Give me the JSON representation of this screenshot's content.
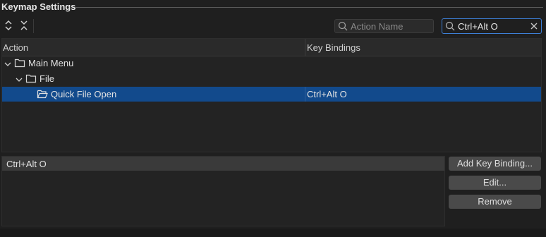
{
  "section": {
    "title": "Keymap Settings"
  },
  "toolbar": {
    "expand_icon": "expand-all-icon",
    "collapse_icon": "collapse-all-icon"
  },
  "search": {
    "action_placeholder": "Action Name",
    "binding_value": "Ctrl+Alt O"
  },
  "table": {
    "columns": [
      "Action",
      "Key Bindings"
    ],
    "rows": [
      {
        "label": "Main Menu",
        "binding": "",
        "type": "folder"
      },
      {
        "label": "File",
        "binding": "",
        "type": "folder"
      },
      {
        "label": "Quick File Open",
        "binding": "Ctrl+Alt O",
        "type": "item",
        "selected": true
      }
    ]
  },
  "bindings_list": {
    "items": [
      "Ctrl+Alt O"
    ]
  },
  "buttons": {
    "add": "Add Key Binding...",
    "edit": "Edit...",
    "remove": "Remove"
  },
  "colors": {
    "selection": "#124a8c",
    "focus_border": "#3d7fd6"
  }
}
